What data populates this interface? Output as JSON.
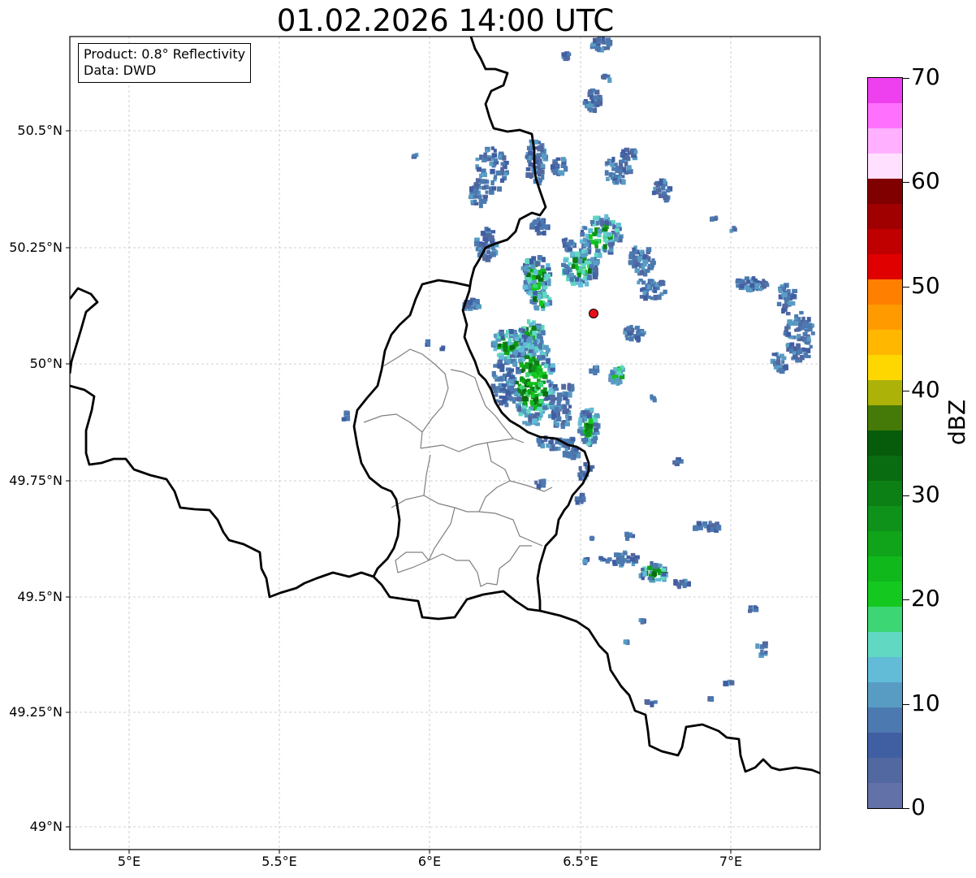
{
  "title": "01.02.2026 14:00 UTC",
  "info": {
    "product": "Product: 0.8° Reflectivity",
    "data": "Data: DWD"
  },
  "map_extent": {
    "lon_min": 4.8,
    "lon_max": 7.3,
    "lat_min": 48.95,
    "lat_max": 50.7
  },
  "y_ticks": [
    "50.5°N",
    "50.25°N",
    "50°N",
    "49.75°N",
    "49.5°N",
    "49.25°N",
    "49°N"
  ],
  "x_ticks": [
    "5°E",
    "5.5°E",
    "6°E",
    "6.5°E",
    "7°E"
  ],
  "radar_site": {
    "lon": 6.55,
    "lat": 50.11,
    "color": "#e8101a"
  },
  "colorbar": {
    "unit": "dBZ",
    "labels": [
      "0",
      "10",
      "20",
      "30",
      "40",
      "50",
      "60",
      "70"
    ],
    "colors": [
      "#6272a8",
      "#5268a0",
      "#405ea2",
      "#4c7ab0",
      "#589cc4",
      "#62bcd8",
      "#60d8c2",
      "#3dd675",
      "#14c81f",
      "#10b81c",
      "#10a41a",
      "#0e921a",
      "#0c8014",
      "#0a6c10",
      "#065c0a",
      "#467a08",
      "#acb208",
      "#ffd700",
      "#ffb700",
      "#ff9b00",
      "#ff7f00",
      "#e00000",
      "#c00000",
      "#a00000",
      "#800000",
      "#ffe0ff",
      "#ffb0ff",
      "#ff70ff",
      "#ee40ee"
    ]
  }
}
